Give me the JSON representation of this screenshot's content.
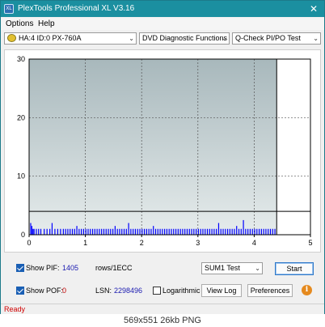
{
  "window": {
    "title": "PlexTools Professional XL V3.16",
    "icon_label": "XL",
    "close_glyph": "✕"
  },
  "menu": {
    "options": "Options",
    "help": "Help"
  },
  "toolbar": {
    "drive": "HA:4 ID:0  PX-760A",
    "function": "DVD Diagnostic Functions",
    "test": "Q-Check PI/PO Test",
    "dropdown_glyph": "⌄"
  },
  "controls": {
    "show_pif_label": "Show PIF:",
    "show_pif_checked": true,
    "pif_value": "1405",
    "rows_label": "rows/1ECC",
    "show_pof_label": "Show POF:",
    "show_pof_checked": true,
    "pof_value": "0",
    "lsn_label": "LSN:",
    "lsn_value": "2298496",
    "sum_select": "SUM1 Test",
    "logarithmic_label": "Logarithmic",
    "logarithmic_checked": false,
    "start_label": "Start",
    "view_log_label": "View Log",
    "preferences_label": "Preferences",
    "info_glyph": "i"
  },
  "status": {
    "text": "Ready"
  },
  "caption": "569x551 26kb PNG",
  "colors": {
    "titlebar": "#1b8fa0",
    "bars": "#0000ff",
    "plot_bg_top": "#a8b8bc",
    "plot_bg_bottom": "#e6ecec"
  },
  "chart_data": {
    "type": "bar",
    "x_ticks": [
      "0",
      "1",
      "2",
      "3",
      "4",
      "5"
    ],
    "y_ticks": [
      "0",
      "10",
      "20",
      "30"
    ],
    "xlim": [
      0,
      5
    ],
    "ylim": [
      0,
      30
    ],
    "threshold": 4,
    "scan_end": 4.4,
    "grid": true,
    "series": [
      {
        "x": [
          0.02,
          0.04,
          0.06,
          0.08,
          0.12,
          0.16,
          0.2,
          0.26,
          0.31,
          0.36,
          0.4,
          0.45,
          0.5,
          0.55,
          0.6,
          0.64,
          0.68,
          0.72,
          0.76,
          0.8,
          0.84,
          0.88,
          0.92,
          0.96,
          1.0,
          1.04,
          1.08,
          1.12,
          1.16,
          1.2,
          1.24,
          1.28,
          1.32,
          1.36,
          1.4,
          1.44,
          1.48,
          1.52,
          1.56,
          1.6,
          1.64,
          1.68,
          1.72,
          1.76,
          1.8,
          1.84,
          1.88,
          1.92,
          1.96,
          2.0,
          2.04,
          2.08,
          2.12,
          2.16,
          2.2,
          2.24,
          2.28,
          2.32,
          2.36,
          2.4,
          2.44,
          2.48,
          2.52,
          2.56,
          2.6,
          2.64,
          2.68,
          2.72,
          2.76,
          2.8,
          2.84,
          2.88,
          2.92,
          2.96,
          3.0,
          3.04,
          3.08,
          3.12,
          3.16,
          3.2,
          3.24,
          3.28,
          3.32,
          3.36,
          3.4,
          3.44,
          3.48,
          3.52,
          3.56,
          3.6,
          3.64,
          3.68,
          3.72,
          3.76,
          3.8,
          3.84,
          3.88,
          3.92,
          3.96,
          4.0,
          4.04,
          4.08,
          4.12,
          4.16,
          4.2,
          4.24,
          4.28,
          4.32,
          4.36
        ],
        "values": [
          2,
          1.5,
          1,
          1,
          1,
          1,
          1,
          1,
          1,
          1,
          2,
          1,
          1,
          1,
          1,
          1,
          1,
          1,
          1,
          1,
          1.5,
          1,
          1,
          1,
          1,
          1,
          1,
          1,
          1,
          1,
          1,
          1,
          1,
          1,
          1,
          1,
          1,
          1.5,
          1,
          1,
          1,
          1,
          1,
          2,
          1,
          1,
          1,
          1,
          1,
          1,
          1,
          1,
          1,
          1,
          1.5,
          1,
          1,
          1,
          1,
          1,
          1,
          1,
          1,
          1,
          1,
          1,
          1,
          1,
          1,
          1,
          1,
          1,
          1,
          1,
          1,
          1,
          1,
          1,
          1,
          1,
          1,
          1,
          1,
          2,
          1,
          1,
          1,
          1,
          1,
          1,
          1,
          1.5,
          1,
          1,
          2.5,
          1,
          1,
          1,
          1,
          1,
          1,
          1,
          1,
          1,
          1,
          1,
          1,
          1,
          1
        ]
      }
    ]
  }
}
